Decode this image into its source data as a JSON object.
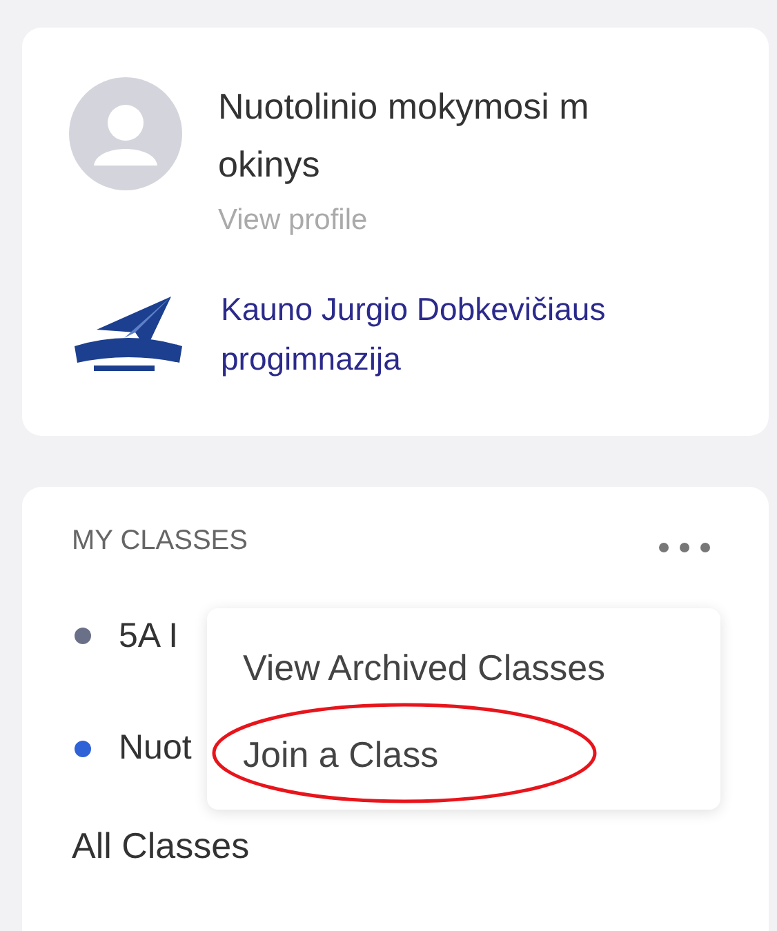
{
  "profile": {
    "name_lines": [
      "Nuotolinio mokymosi m",
      "okinys"
    ],
    "view_profile": "View profile",
    "school": "Kauno Jurgio Dobkevičiaus progimnazija"
  },
  "classes": {
    "title": "MY CLASSES",
    "items": [
      {
        "label": "5A I",
        "color": "#6b7089"
      },
      {
        "label": "Nuot",
        "color": "#2f62d6"
      }
    ],
    "all_classes": "All Classes",
    "menu": [
      {
        "label": "View Archived Classes",
        "highlighted": false
      },
      {
        "label": "Join a Class",
        "highlighted": true
      }
    ]
  }
}
